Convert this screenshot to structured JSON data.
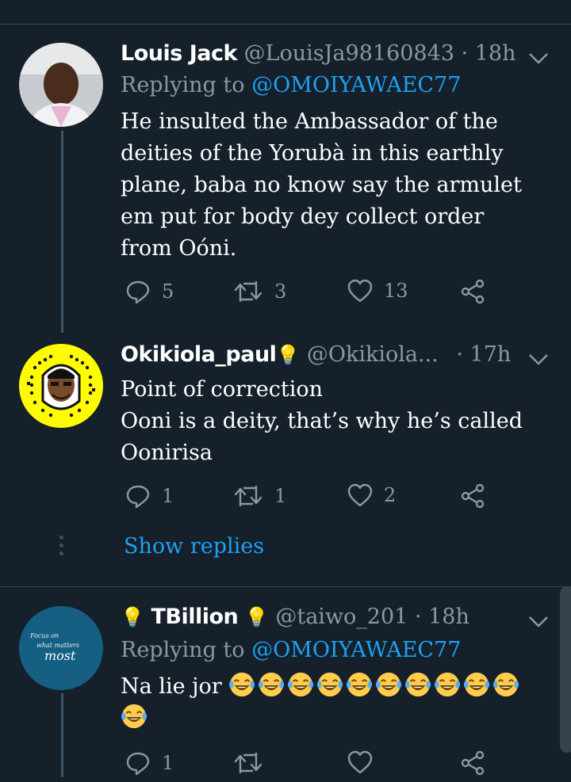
{
  "tweets": [
    {
      "name": "Louis Jack",
      "handle": "@LouisJa98160843",
      "time": "· 18h",
      "replying_prefix": "Replying to",
      "replying_to": "@OMOIYAWAEC77",
      "lines": [
        "He insulted the Ambassador of the",
        "deities of the Yorubà in this earthly",
        "plane, baba no know say the armulet",
        "em put for body dey collect order",
        "from Oóni."
      ],
      "replies": "5",
      "retweets": "3",
      "likes": "13"
    },
    {
      "name": "Okikiola_paul",
      "name_emoji": "💡",
      "handle": "@Okikiola...",
      "time": "· 17h",
      "lines": [
        "Point of correction",
        "Ooni is a deity, that’s why he’s called",
        "Oonirisa"
      ],
      "replies": "1",
      "retweets": "1",
      "likes": "2",
      "show_replies": "Show replies"
    },
    {
      "name": "TBillion",
      "name_emoji": "💡",
      "handle": "@taiwo_201",
      "time": "· 18h",
      "replying_prefix": "Replying to",
      "replying_to": "@OMOIYAWAEC77",
      "text": "Na lie jor",
      "emoji_count": 11,
      "replies": "1",
      "retweets": "",
      "likes": "",
      "avatar_text": [
        "Focus on",
        "what matters",
        "most"
      ]
    }
  ],
  "colors": {
    "background": "#15202b",
    "muted": "#8899a6",
    "link": "#1da1f2",
    "divider": "#38444d"
  },
  "icons": [
    "reply-icon",
    "retweet-icon",
    "like-icon",
    "share-icon",
    "chevron-down-icon",
    "lightbulb-icon",
    "laughing-emoji-icon"
  ]
}
